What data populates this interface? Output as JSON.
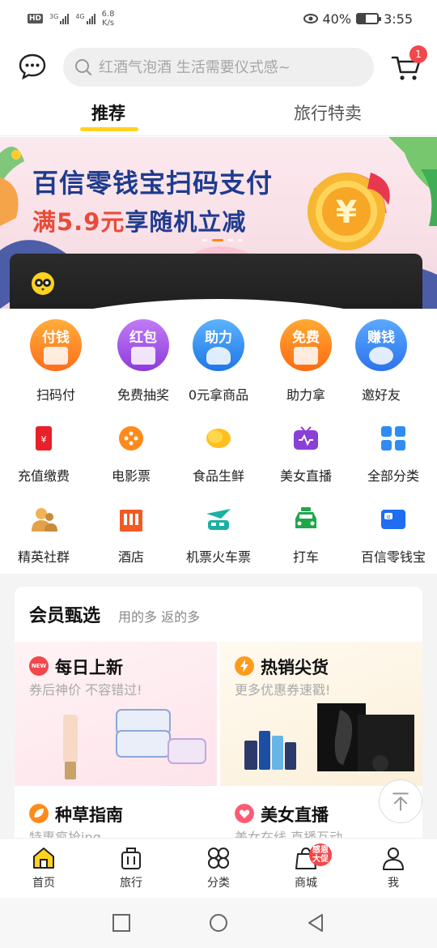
{
  "status_bar": {
    "hd": "HD",
    "signal1": "3G",
    "signal2": "4G",
    "speed_value": "6.8",
    "speed_unit": "K/s",
    "battery_percent": "40%",
    "battery_level": 0.4,
    "time": "3:55"
  },
  "header": {
    "search_placeholder": "红酒气泡酒 生活需要仪式感~",
    "cart_badge": "1"
  },
  "tabs": [
    {
      "label": "推荐",
      "active": true
    },
    {
      "label": "旅行特卖",
      "active": false
    }
  ],
  "banner": {
    "line1": "百信零钱宝扫码支付",
    "line2_highlight": "满5.9元",
    "line2_rest": "享随机立减",
    "coin_symbol": "¥"
  },
  "quick_actions": [
    {
      "tag": "付钱",
      "label": "扫码付",
      "color": "#ff8a1f"
    },
    {
      "tag": "红包",
      "label": "免费抽奖",
      "color": "#a64be8"
    },
    {
      "tag": "助力",
      "label": "0元拿商品",
      "color": "#2e8cf0"
    },
    {
      "tag": "免费",
      "label": "助力拿",
      "color": "#ff7a1a"
    },
    {
      "tag": "赚钱",
      "label": "邀好友",
      "color": "#3a8ef5"
    }
  ],
  "grid": [
    {
      "label": "充值缴费",
      "icon": "phone-recharge-icon"
    },
    {
      "label": "电影票",
      "icon": "film-reel-icon"
    },
    {
      "label": "食品生鲜",
      "icon": "lemon-icon"
    },
    {
      "label": "美女直播",
      "icon": "tv-live-icon"
    },
    {
      "label": "全部分类",
      "icon": "category-grid-icon"
    },
    {
      "label": "精英社群",
      "icon": "people-icon"
    },
    {
      "label": "酒店",
      "icon": "hotel-icon"
    },
    {
      "label": "机票火车票",
      "icon": "plane-train-icon"
    },
    {
      "label": "打车",
      "icon": "taxi-icon"
    },
    {
      "label": "百信零钱宝",
      "icon": "wallet-icon"
    }
  ],
  "member": {
    "title": "会员甄选",
    "subtitle": "用的多 返的多",
    "cards": [
      {
        "title": "每日上新",
        "subtitle": "券后神价 不容错过!",
        "badge": "NEW"
      },
      {
        "title": "热销尖货",
        "subtitle": "更多优惠券速戳!"
      },
      {
        "title": "种草指南",
        "subtitle": "特惠疯抢ing"
      },
      {
        "title": "美女直播",
        "subtitle": "美女在线 直播互动"
      }
    ]
  },
  "bottom_nav": [
    {
      "label": "首页",
      "icon": "home-icon",
      "active": true
    },
    {
      "label": "旅行",
      "icon": "luggage-icon"
    },
    {
      "label": "分类",
      "icon": "category-icon"
    },
    {
      "label": "商城",
      "icon": "shop-bag-icon",
      "badge": "感恩大促"
    },
    {
      "label": "我",
      "icon": "person-icon"
    }
  ],
  "colors": {
    "accent_yellow": "#ffd21f",
    "badge_red": "#f2474b",
    "banner_blue": "#1f3b8e",
    "banner_red": "#ea4b38"
  }
}
